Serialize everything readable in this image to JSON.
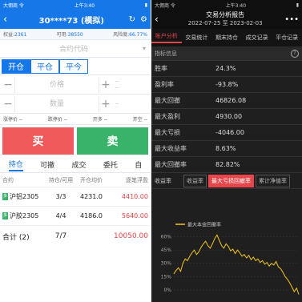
{
  "left": {
    "status": {
      "left": "大佣商 令",
      "time": "上午3:40",
      "right": "▮"
    },
    "nav": {
      "account": "30****73 (模拟)"
    },
    "info": [
      {
        "label": "权益:",
        "value": "2361"
      },
      {
        "label": "可用:",
        "value": "38550"
      },
      {
        "label": "风险度:",
        "value": "66.77%"
      }
    ],
    "contract_placeholder": "合约代码",
    "modes": [
      "开仓",
      "平仓",
      "平今"
    ],
    "price_placeholder": "价格",
    "qty_placeholder": "数量",
    "side_lines": [
      "--",
      "--",
      "--"
    ],
    "avail": [
      "涨停价 --",
      "跌停价 --",
      "开多 --",
      "开空 --"
    ],
    "buy_label": "买",
    "sell_label": "卖",
    "tabs": [
      "持仓",
      "可撤",
      "成交",
      "委托",
      "自"
    ],
    "columns": [
      "合约",
      "持仓/可用",
      "开仓均价",
      "逐笔浮盈"
    ],
    "rows": [
      {
        "contract": "沪铝2305",
        "position": "3/3",
        "open_price": "4231.0",
        "pnl": "4410.00"
      },
      {
        "contract": "沪胶2305",
        "position": "4/4",
        "open_price": "4186.0",
        "pnl": "5640.00"
      }
    ],
    "total": {
      "label": "合计 (2)",
      "position": "7/7",
      "pnl": "10050.00"
    }
  },
  "right": {
    "status": {
      "left": "大佣商 令",
      "time": "上午3:40",
      "right": "▮"
    },
    "nav": {
      "title": "交易分析报告",
      "range": "2022-07-25 至 2023-02-03"
    },
    "tabs": [
      "账户分析",
      "交易统计",
      "期末持仓",
      "成交记录",
      "平仓记录"
    ],
    "section": "指标信息",
    "metrics": [
      {
        "key": "胜率",
        "value": "24.3%"
      },
      {
        "key": "盈利率",
        "value": "-93.8%"
      },
      {
        "key": "最大回撤",
        "value": "46826.08"
      },
      {
        "key": "最大盈利",
        "value": "4930.00"
      },
      {
        "key": "最大亏损",
        "value": "-4046.00"
      },
      {
        "key": "最大收益率",
        "value": "8.63%"
      },
      {
        "key": "最大回撤率",
        "value": "82.82%"
      }
    ],
    "curve_label": "收益率",
    "curve_buttons": [
      "收益率",
      "最大亏损回撤率",
      "累计净值率"
    ],
    "chart_data": {
      "type": "line",
      "title": "",
      "legend": "最大本金回撤率",
      "yticks": [
        "60%",
        "45%",
        "30%",
        "15%",
        "0%"
      ],
      "ylim": [
        -10,
        65
      ],
      "x": [
        0,
        1,
        2,
        3,
        4,
        5,
        6,
        7,
        8,
        9,
        10,
        11,
        12,
        13,
        14,
        15,
        16,
        17,
        18,
        19,
        20,
        21,
        22,
        23,
        24,
        25,
        26,
        27,
        28,
        29,
        30,
        31,
        32,
        33,
        34,
        35,
        36,
        37,
        38,
        39,
        40,
        41,
        42,
        43,
        44,
        45,
        46,
        47,
        48,
        49,
        50,
        51,
        52,
        53,
        54,
        55
      ],
      "values": [
        18,
        22,
        25,
        21,
        30,
        35,
        33,
        38,
        42,
        45,
        40,
        43,
        48,
        52,
        55,
        50,
        47,
        52,
        58,
        62,
        56,
        50,
        47,
        52,
        49,
        44,
        46,
        41,
        45,
        42,
        38,
        40,
        36,
        39,
        34,
        37,
        33,
        35,
        31,
        33,
        29,
        31,
        27,
        30,
        28,
        32,
        26,
        24,
        20,
        15,
        12,
        8,
        3,
        -2,
        2,
        -5
      ]
    }
  }
}
